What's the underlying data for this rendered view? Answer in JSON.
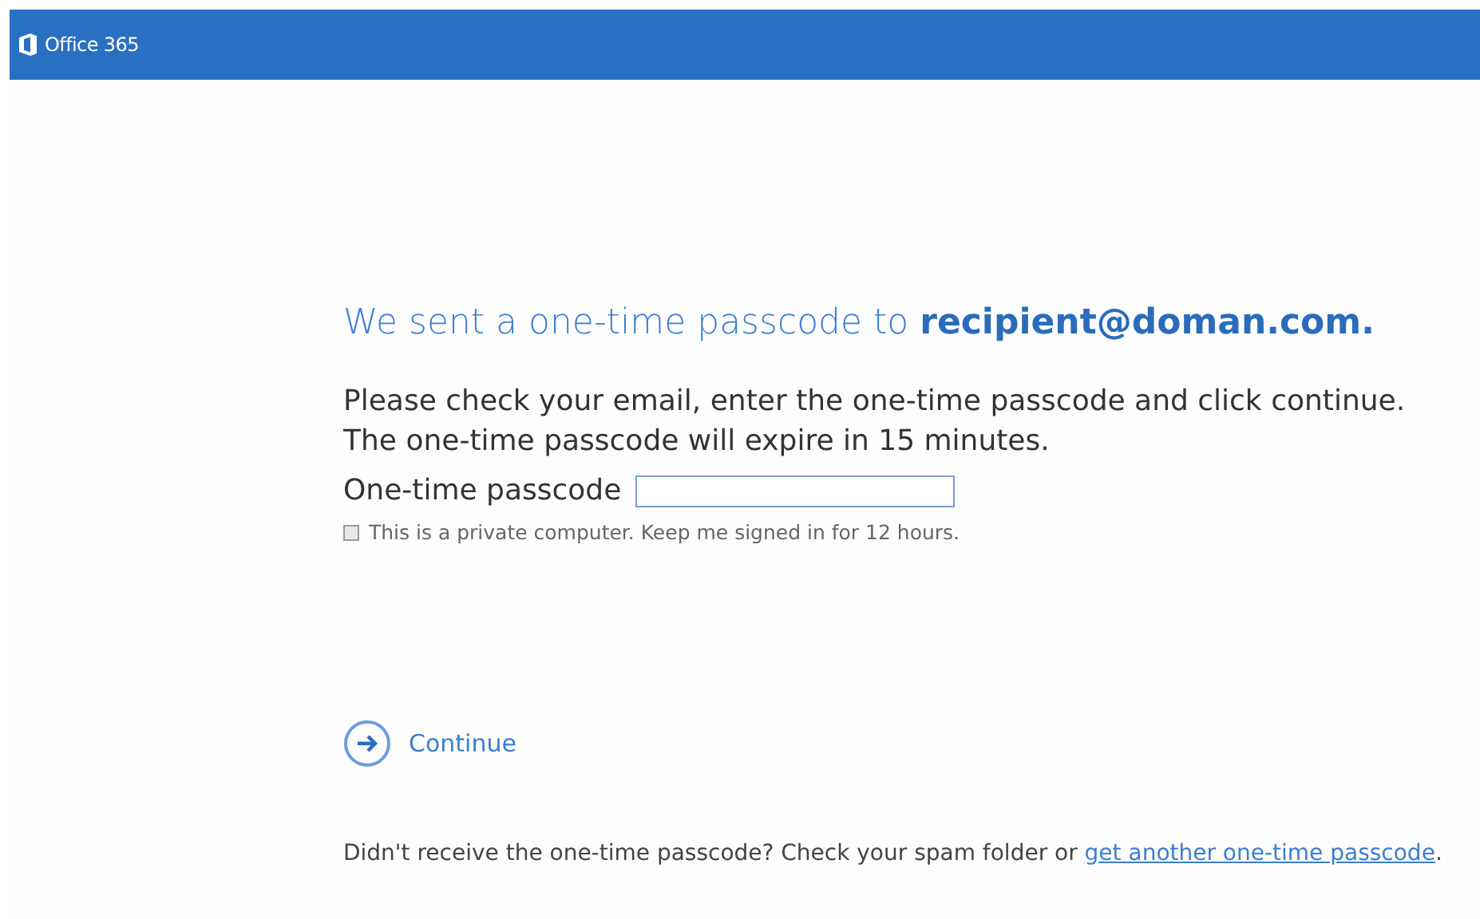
{
  "header": {
    "brand": "Office 365"
  },
  "heading": "We sent a one-time passcode to **recipient@doman.com.**",
  "instructions": [
    "Please check your email, enter the one-time passcode and click continue.",
    "The one-time passcode will expire in 15 minutes."
  ],
  "passcode_field": {
    "label": "One-time passcode"
  },
  "keep_signed_in": {
    "label": "This is a private computer. Keep me signed in for 12 hours.",
    "checked": false
  },
  "continue_button": {
    "label": "Continue"
  },
  "footer": {
    "text": "Didn't receive the one-time passcode? Check your spam folder or",
    "link": "get another one-time passcode",
    "trailing": "."
  }
}
